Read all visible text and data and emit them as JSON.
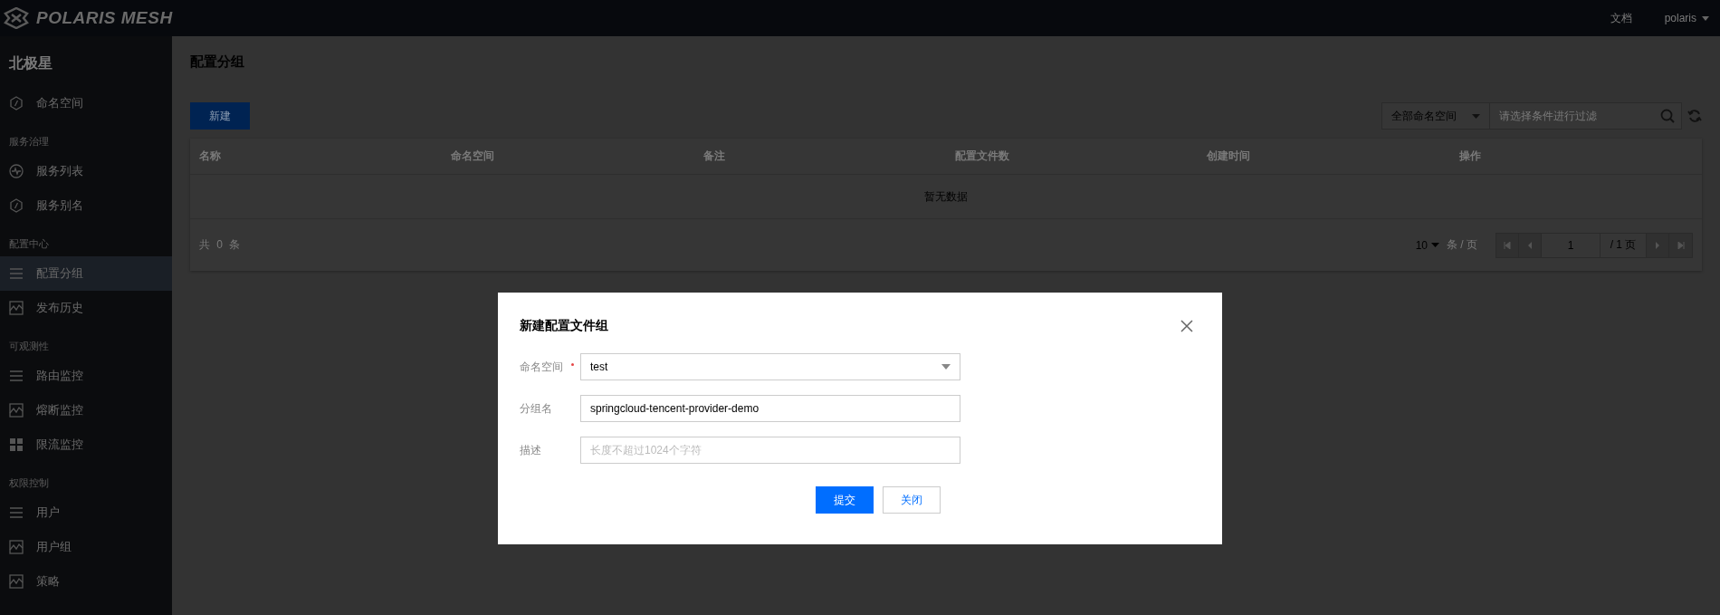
{
  "header": {
    "logo": "POLARIS MESH",
    "links": [
      {
        "label": "文档",
        "dropdown": false
      },
      {
        "label": "polaris",
        "dropdown": true
      }
    ]
  },
  "sidebar": {
    "title": "北极星",
    "sections": [
      {
        "items": [
          {
            "label": "命名空间",
            "kind": "hexagon",
            "selected": false
          }
        ]
      },
      {
        "heading": "服务治理",
        "items": [
          {
            "label": "服务列表",
            "kind": "pulse",
            "selected": false
          },
          {
            "label": "服务别名",
            "kind": "hexagon",
            "selected": false
          }
        ]
      },
      {
        "heading": "配置中心",
        "items": [
          {
            "label": "配置分组",
            "kind": "list",
            "selected": true
          },
          {
            "label": "发布历史",
            "kind": "chart",
            "selected": false
          }
        ]
      },
      {
        "heading": "可观测性",
        "items": [
          {
            "label": "路由监控",
            "kind": "list",
            "selected": false
          },
          {
            "label": "熔断监控",
            "kind": "chart",
            "selected": false
          },
          {
            "label": "限流监控",
            "kind": "grid",
            "selected": false
          }
        ]
      },
      {
        "heading": "权限控制",
        "items": [
          {
            "label": "用户",
            "kind": "list",
            "selected": false
          },
          {
            "label": "用户组",
            "kind": "chart",
            "selected": false
          },
          {
            "label": "策略",
            "kind": "chart",
            "selected": false
          }
        ]
      }
    ]
  },
  "page": {
    "title": "配置分组",
    "new_button": "新建",
    "namespace_filter": "全部命名空间",
    "search": {
      "placeholder": "请选择条件进行过滤"
    }
  },
  "table": {
    "columns": [
      "名称",
      "命名空间",
      "备注",
      "配置文件数",
      "创建时间",
      "操作"
    ],
    "empty_text": "暂无数据",
    "footer": {
      "total": "共 0 条",
      "page_size": "10",
      "page_size_unit": "条 / 页",
      "page": "1",
      "total_pages": "/ 1 页"
    }
  },
  "modal": {
    "title": "新建配置文件组",
    "fields": [
      {
        "label": "命名空间",
        "required": true,
        "kind": "select",
        "value": "test"
      },
      {
        "label": "分组名",
        "required": false,
        "kind": "input",
        "value": "springcloud-tencent-provider-demo"
      },
      {
        "label": "描述",
        "required": false,
        "kind": "input",
        "placeholder": "长度不超过1024个字符"
      }
    ],
    "buttons": [
      {
        "label": "提交",
        "kind": "primary"
      },
      {
        "label": "关闭",
        "kind": "default"
      }
    ]
  }
}
